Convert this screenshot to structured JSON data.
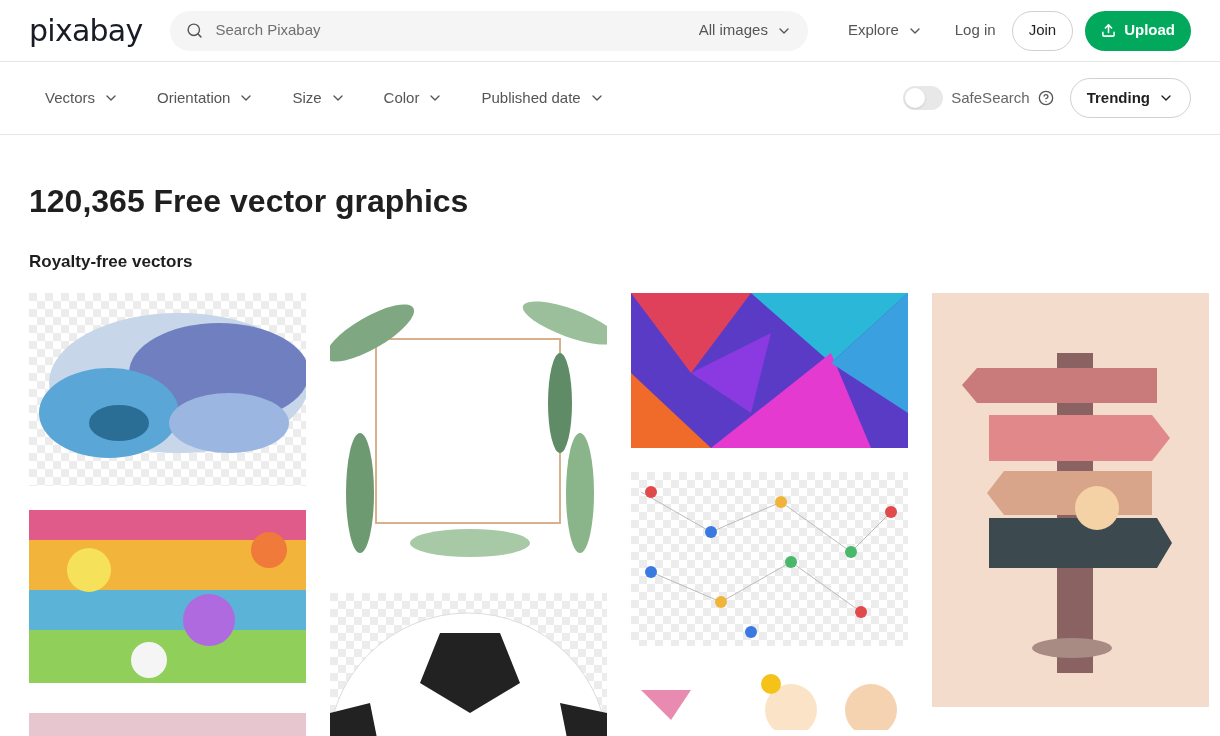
{
  "header": {
    "logo": "pixabay",
    "search": {
      "placeholder": "Search Pixabay",
      "scope": "All images"
    },
    "nav": [
      "Explore"
    ],
    "login": "Log in",
    "join": "Join",
    "upload": "Upload"
  },
  "filters": [
    {
      "label": "Vectors"
    },
    {
      "label": "Orientation"
    },
    {
      "label": "Size"
    },
    {
      "label": "Color"
    },
    {
      "label": "Published date"
    }
  ],
  "safesearch": {
    "label": "SafeSearch",
    "on": false
  },
  "sort": "Trending",
  "heading": "120,365 Free vector graphics",
  "section": "Royalty-free vectors"
}
